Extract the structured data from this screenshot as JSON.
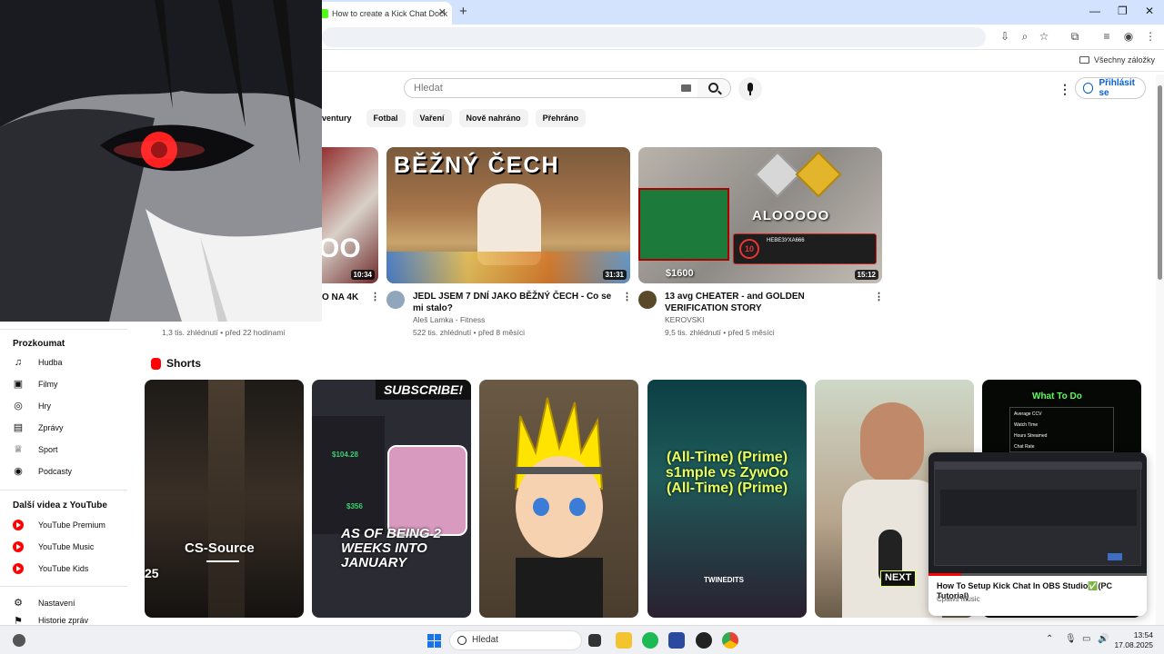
{
  "browser": {
    "tab_title": "How to create a Kick Chat Dock",
    "bookmarks_label": "Všechny záložky"
  },
  "youtube": {
    "search_placeholder": "Hledat",
    "signin_label": "Přihlásit se",
    "chips": [
      "ventury",
      "Fotbal",
      "Vaření",
      "Nově nahráno",
      "Přehráno"
    ]
  },
  "videos": [
    {
      "title": "O NA 4K",
      "channel": "",
      "meta": "1,3 tis. zhlédnutí • před 22 hodinami",
      "duration": "10:34",
      "thumb_text": "OO"
    },
    {
      "title": "JEDL JSEM 7 DNÍ JAKO BĚŽNÝ ČECH - Co se mi stalo?",
      "channel": "Aleš Lamka - Fitness",
      "meta": "522 tis. zhlédnutí • před 8 měsíci",
      "duration": "31:31",
      "thumb_text": "BĚŽNÝ ČECH"
    },
    {
      "title": "13 avg CHEATER - and GOLDEN VERIFICATION STORY",
      "channel": "KEROVSKI",
      "meta": "9,5 tis. zhlédnutí • před 5 měsíci",
      "duration": "15:12",
      "thumb_text": "ALOOOOO",
      "thumb_price": "$1600",
      "thumb_name": "НЕВЕЗУХА666"
    }
  ],
  "sidebar": {
    "explore_heading": "Prozkoumat",
    "explore": [
      {
        "label": "Hudba",
        "icon": "music-icon"
      },
      {
        "label": "Filmy",
        "icon": "film-icon"
      },
      {
        "label": "Hry",
        "icon": "gamepad-icon"
      },
      {
        "label": "Zprávy",
        "icon": "news-icon"
      },
      {
        "label": "Sport",
        "icon": "trophy-icon"
      },
      {
        "label": "Podcasty",
        "icon": "podcast-icon"
      }
    ],
    "more_heading": "Další videa z YouTube",
    "more": [
      {
        "label": "YouTube Premium"
      },
      {
        "label": "YouTube Music"
      },
      {
        "label": "YouTube Kids"
      }
    ],
    "settings": [
      {
        "label": "Nastavení",
        "icon": "gear-icon"
      },
      {
        "label": "Historie zpráv",
        "icon": "flag-icon"
      }
    ]
  },
  "shorts": {
    "heading": "Shorts",
    "items": [
      {
        "caption": "CS-Source",
        "extra": "25"
      },
      {
        "caption": "AS OF BEING 2 WEEKS INTO JANUARY",
        "banner": "SUBSCRIBE!",
        "amount1": "$104.28",
        "amount2": "$356"
      },
      {
        "caption": ""
      },
      {
        "caption": "(All-Time) (Prime) s1mple vs ZywOo (All-Time) (Prime)",
        "tag": "TWINEDITS"
      },
      {
        "caption": "NEXT"
      },
      {
        "caption": "What To Do",
        "list": [
          "Average CCV",
          "Watch Time",
          "Hours Streamed",
          "Chat Rate"
        ]
      }
    ]
  },
  "miniplayer": {
    "title": "How To Setup Kick Chat In OBS Studio✅(PC Tutorial)",
    "channel": "Cpaws Music"
  },
  "taskbar": {
    "search_label": "Hledat",
    "time": "13:54",
    "date": "17.08.2025"
  },
  "colors": {
    "accent": "#065fd4",
    "youtube_red": "#ff0000",
    "kick_green": "#53fc18"
  }
}
